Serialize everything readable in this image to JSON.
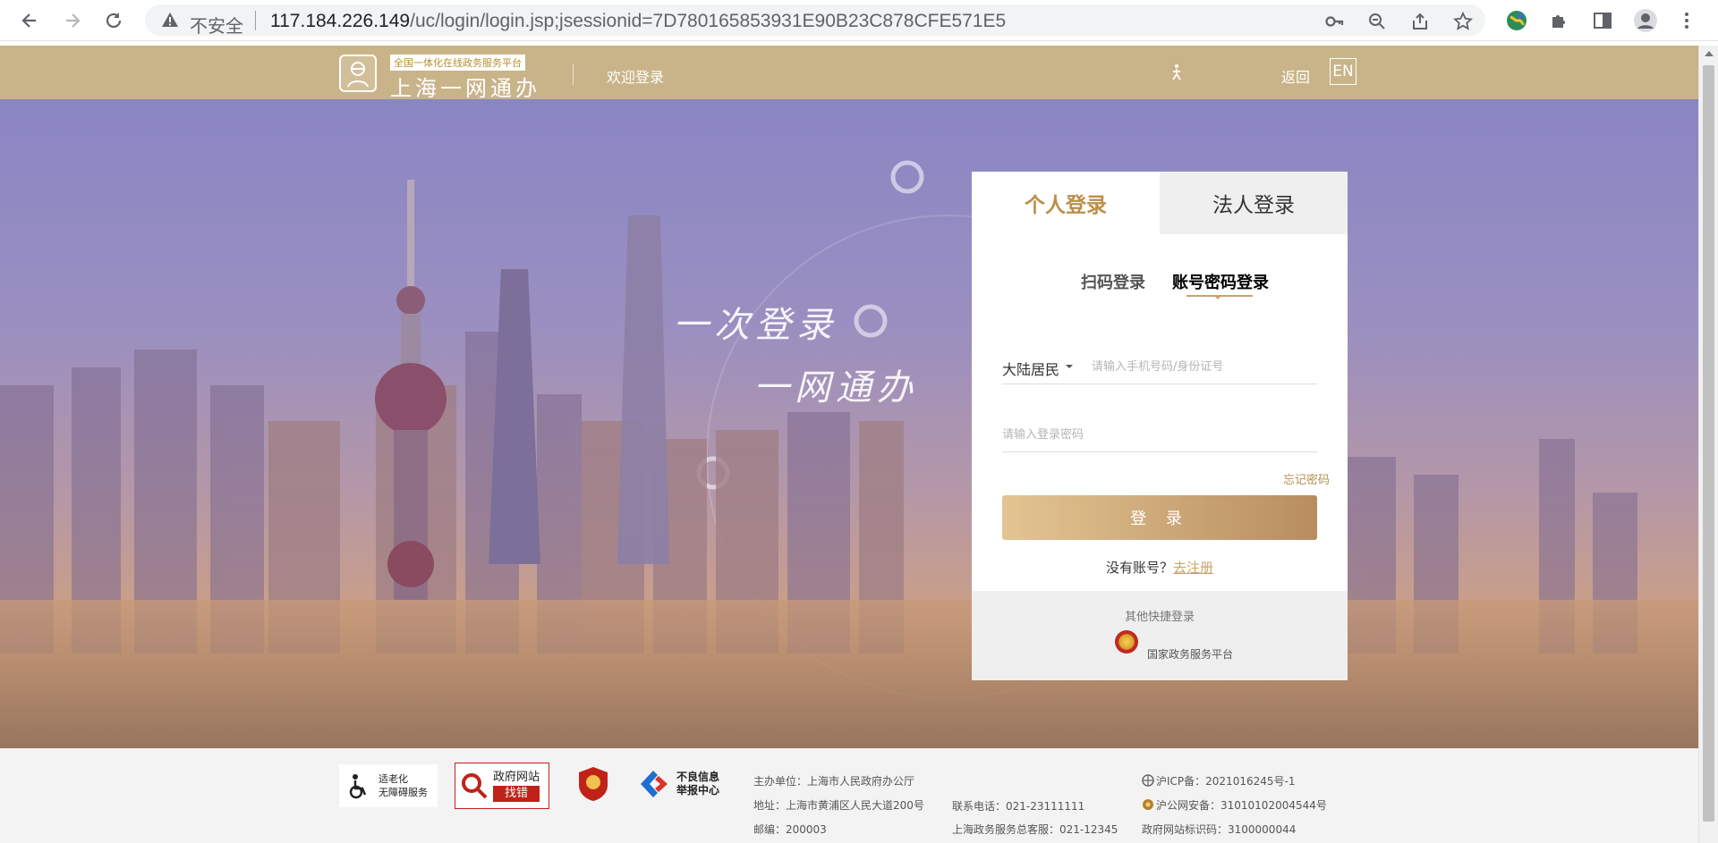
{
  "browser": {
    "security_label": "不安全",
    "url_host": "117.184.226.149",
    "url_path": "/uc/login/login.jsp;jsessionid=7D780165853931E90B23C878CFE571E5"
  },
  "header": {
    "logo_tag": "全国一体化在线政务服务平台",
    "logo_name": "上海一网通办",
    "welcome": "欢迎登录",
    "back": "返回",
    "lang": "EN"
  },
  "hero": {
    "slogan_line1": "一次登录",
    "slogan_line2": "一网通办"
  },
  "login": {
    "tab_personal": "个人登录",
    "tab_legal": "法人登录",
    "sub_qr": "扫码登录",
    "sub_password": "账号密码登录",
    "resident_type": "大陆居民",
    "account_placeholder": "请输入手机号码/身份证号",
    "password_placeholder": "请输入登录密码",
    "forgot": "忘记密码",
    "submit": "登 录",
    "no_account": "没有账号？",
    "register": "去注册",
    "quick_title": "其他快捷登录",
    "national_platform": "国家政务服务平台"
  },
  "footer": {
    "badge_elder_line1": "适老化",
    "badge_elder_line2": "无障碍服务",
    "badge_error_line1": "政府网站",
    "badge_error_line2": "找错",
    "badge_report_line1": "不良信息",
    "badge_report_line2": "举报中心",
    "host": "主办单位：上海市人民政府办公厅",
    "address": "地址：上海市黄浦区人民大道200号",
    "postcode": "邮编：200003",
    "phone": "联系电话：021-23111111",
    "hotline": "上海政务服务总客服：021-12345",
    "icp": "沪ICP备：2021016245号-1",
    "police": "沪公网安备：31010102004544号",
    "site_id": "政府网站标识码：3100000044"
  }
}
